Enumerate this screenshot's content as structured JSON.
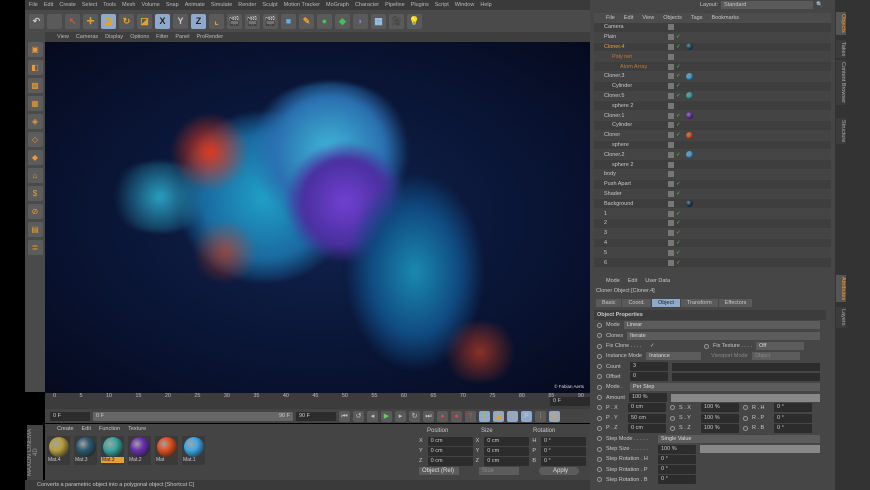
{
  "menubar": [
    "File",
    "Edit",
    "Create",
    "Select",
    "Tools",
    "Mesh",
    "Volume",
    "Snap",
    "Animate",
    "Simulate",
    "Render",
    "Sculpt",
    "Motion Tracker",
    "MoGraph",
    "Character",
    "Pipeline",
    "Plugins",
    "Script",
    "Window",
    "Help"
  ],
  "toolbar": {
    "x": "X",
    "y": "Y",
    "z": "Z"
  },
  "viewport_menu": [
    "View",
    "Cameras",
    "Display",
    "Options",
    "Filter",
    "Panel",
    "ProRender"
  ],
  "watermark": "© Fabian Aerts",
  "timeline": {
    "ticks": [
      "0",
      "5",
      "10",
      "15",
      "20",
      "25",
      "30",
      "35",
      "40",
      "45",
      "50",
      "55",
      "60",
      "65",
      "70",
      "75",
      "80",
      "85",
      "90"
    ],
    "current_frame": "0 F",
    "start": "0 F",
    "range_start": "0 F",
    "range_end": "90 F",
    "end": "90 F"
  },
  "materials": {
    "menu": [
      "Create",
      "Edit",
      "Function",
      "Texture"
    ],
    "items": [
      {
        "name": "Mat.4",
        "color": "#b8a040"
      },
      {
        "name": "Mat.3",
        "color": "#2e5a70"
      },
      {
        "name": "Mat.3",
        "color": "#3aa8a0",
        "selected": true
      },
      {
        "name": "Mat.2",
        "color": "#6a30b0"
      },
      {
        "name": "Mat",
        "color": "#e05020"
      },
      {
        "name": "Mat.1",
        "color": "#40a8e8"
      }
    ]
  },
  "brand": "MAXON CINEMA 4D",
  "coords": {
    "headers": [
      "Position",
      "Size",
      "Rotation"
    ],
    "rows": [
      [
        "X",
        "0 cm",
        "X",
        "0 cm",
        "H",
        "0 °"
      ],
      [
        "Y",
        "0 cm",
        "Y",
        "0 cm",
        "P",
        "0 °"
      ],
      [
        "Z",
        "0 cm",
        "Z",
        "0 cm",
        "B",
        "0 °"
      ]
    ],
    "mode": "Object (Rel)",
    "size_mode": "Size",
    "apply": "Apply"
  },
  "status": "Converts a parametric object into a polygonal object [Shortcut C]",
  "layout": {
    "label": "Layout:",
    "value": "Standard"
  },
  "objects_menu": [
    "File",
    "Edit",
    "View",
    "Objects",
    "Tags",
    "Bookmarks"
  ],
  "objects": [
    {
      "name": "Camera",
      "check": false,
      "tag": null
    },
    {
      "name": "Plain",
      "check": true,
      "tag": null
    },
    {
      "name": "Cloner.4",
      "check": true,
      "tag": "#1e4a60",
      "hl": "#e8a030"
    },
    {
      "name": "Poly net",
      "check": false,
      "tag": null,
      "hl": "#c87830",
      "indent": 1
    },
    {
      "name": "Atom Array",
      "check": true,
      "tag": null,
      "hl": "#c87830",
      "indent": 2
    },
    {
      "name": "Cloner.3",
      "check": true,
      "tag": "#3aa0d8"
    },
    {
      "name": "Cylinder",
      "check": true,
      "tag": null,
      "indent": 1
    },
    {
      "name": "Cloner.5",
      "check": true,
      "tag": "#3a9a98"
    },
    {
      "name": "sphere 2",
      "check": false,
      "tag": null,
      "indent": 1
    },
    {
      "name": "Cloner.1",
      "check": true,
      "tag": "#6030a8"
    },
    {
      "name": "Cylinder",
      "check": true,
      "tag": null,
      "indent": 1
    },
    {
      "name": "Cloner",
      "check": true,
      "tag": "#d84a20"
    },
    {
      "name": "sphere",
      "check": false,
      "tag": null,
      "indent": 1
    },
    {
      "name": "Cloner.2",
      "check": true,
      "tag": "#40a0e0"
    },
    {
      "name": "sphere 2",
      "check": false,
      "tag": null,
      "indent": 1
    },
    {
      "name": "body",
      "check": false,
      "tag": null
    },
    {
      "name": "Push Apart",
      "check": true,
      "tag": null
    },
    {
      "name": "Shader",
      "check": true,
      "tag": null
    },
    {
      "name": "Background",
      "check": false,
      "tag": "#1e3a50"
    },
    {
      "name": "1",
      "check": true,
      "tag": null
    },
    {
      "name": "2",
      "check": true,
      "tag": null
    },
    {
      "name": "3",
      "check": true,
      "tag": null
    },
    {
      "name": "4",
      "check": true,
      "tag": null
    },
    {
      "name": "5",
      "check": true,
      "tag": null
    },
    {
      "name": "6",
      "check": true,
      "tag": null
    }
  ],
  "attr_menu": [
    "Mode",
    "Edit",
    "User Data"
  ],
  "attr_title": "Cloner Object [Cloner.4]",
  "attr_tabs": [
    {
      "label": "Basic"
    },
    {
      "label": "Coord."
    },
    {
      "label": "Object",
      "active": true
    },
    {
      "label": "Transform"
    },
    {
      "label": "Effectors"
    }
  ],
  "attr": {
    "section": "Object Properties",
    "mode_label": "Mode",
    "mode": "Linear",
    "clones_label": "Clones",
    "clones": "Iterate",
    "fix_clone": "Fix Clone . . . .",
    "fix_clone_check": "✓",
    "fix_texture": "Fix Texture . . . .",
    "fix_texture_val": "Off",
    "instance_mode": "Instance Mode",
    "instance_val": "Instance",
    "viewport_mode": "Viewport Mode",
    "viewport_val": "Object",
    "count_label": "Count",
    "count": "3",
    "offset_label": "Offset",
    "offset": "0",
    "mode2_label": "Mode .",
    "mode2": "Per Step",
    "amount_label": "Amount",
    "amount": "100 %",
    "grid": [
      [
        "P . X",
        "0 cm",
        "S . X",
        "100 %",
        "R . H",
        "0 °"
      ],
      [
        "P . Y",
        "50 cm",
        "S . Y",
        "100 %",
        "R . P",
        "0 °"
      ],
      [
        "P . Z",
        "0 cm",
        "S . Z",
        "100 %",
        "R . B",
        "0 °"
      ]
    ],
    "step_mode_label": "Step Mode . . . . .",
    "step_mode": "Single Value",
    "step_size_label": "Step Size . . . . . .",
    "step_size": "100 %",
    "step_rot": [
      {
        "label": "Step Rotation . H",
        "value": "0 °"
      },
      {
        "label": "Step Rotation . P",
        "value": "0 °"
      },
      {
        "label": "Step Rotation . B",
        "value": "0 °"
      }
    ]
  },
  "vtabs": {
    "top": [
      {
        "label": "Objects",
        "active": true
      },
      {
        "label": "Takes"
      },
      {
        "label": "Content Browser"
      },
      {
        "label": "Structure"
      }
    ],
    "bottom": [
      {
        "label": "Attributes",
        "active": true
      },
      {
        "label": "Layers"
      }
    ]
  }
}
